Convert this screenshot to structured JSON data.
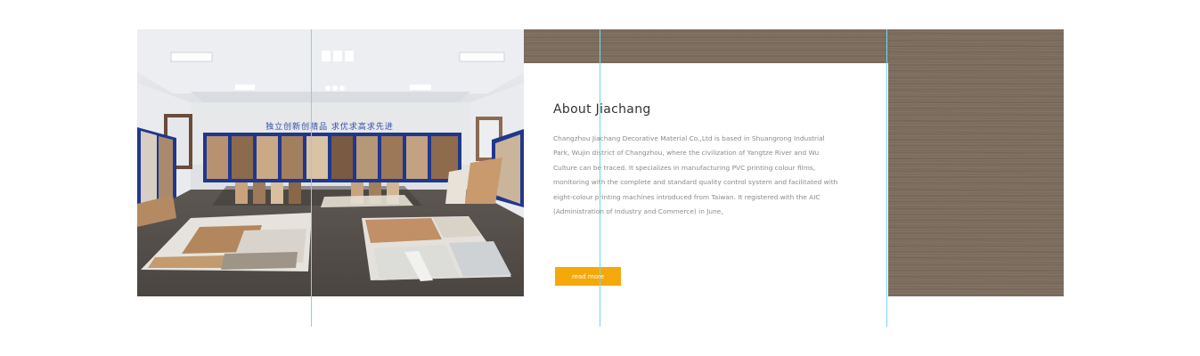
{
  "section": {
    "title": "About Jiachang",
    "body": "Changzhou Jiachang Decorative Material Co.,Ltd is based in Shuangrong Industrial Park, Wujin district of Changzhou, where the civilization of Yangtze River and Wu Culture can be traced. It specializes in manufacturing PVC printing colour films, monitoring with the complete and standard quality control system and facilitated with eight-colour printing machines introduced from Taiwan. It registered with the AIC (Administration of Industry and Commerce) in June,",
    "button_label": "read more"
  },
  "photo": {
    "banner_text": "独立创新创精品  求优求高求先进"
  },
  "colors": {
    "wood": "#7d6d5f",
    "accent": "#f5a80a",
    "guide": "#74d8ee",
    "title": "#333333",
    "body_text": "#8a8a8a"
  }
}
